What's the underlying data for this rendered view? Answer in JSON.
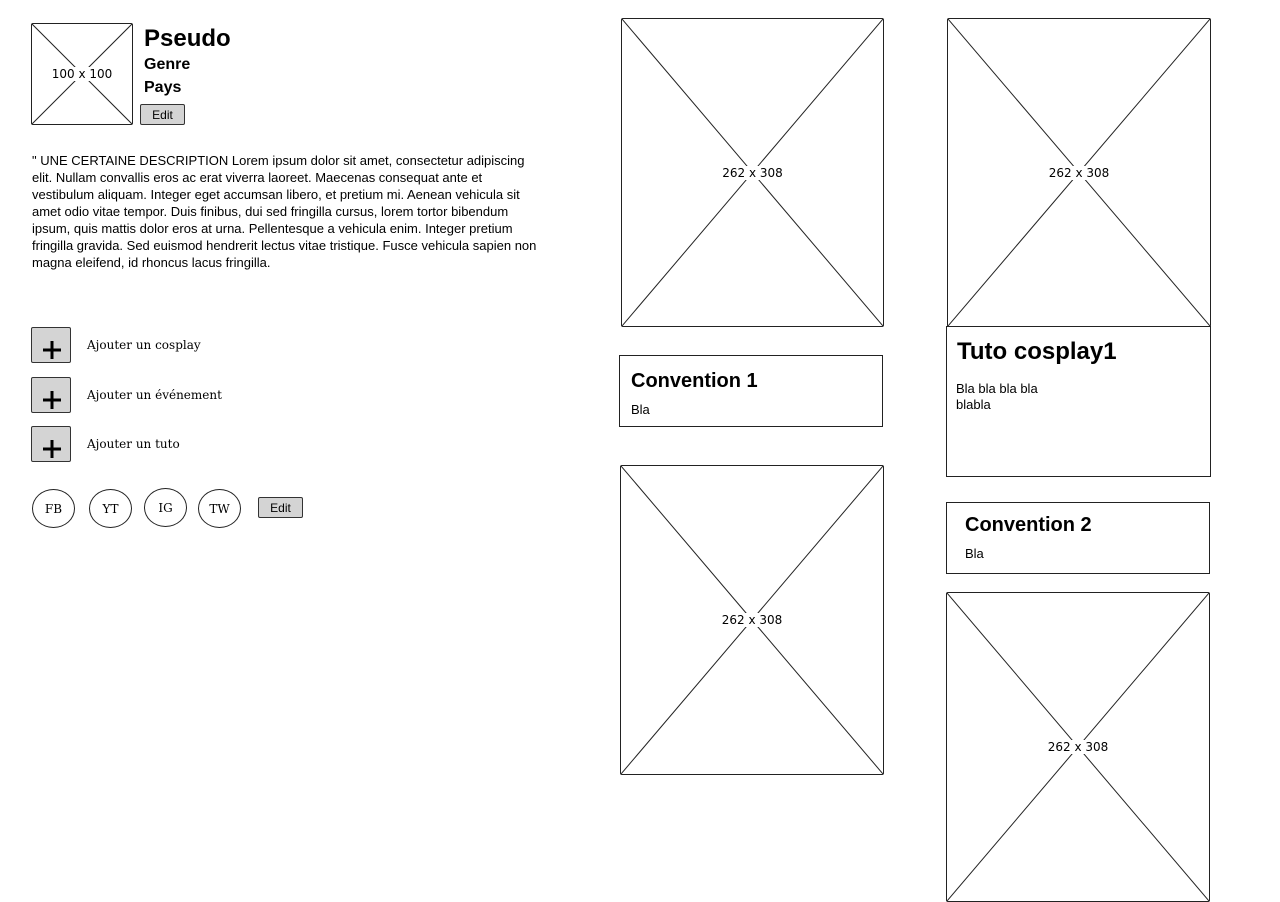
{
  "profile": {
    "avatar_label": "100 x 100",
    "pseudo": "Pseudo",
    "genre": "Genre",
    "pays": "Pays",
    "edit_label": "Edit",
    "description": "\" UNE CERTAINE DESCRIPTION Lorem ipsum dolor sit amet, consectetur adipiscing elit. Nullam convallis eros ac erat viverra laoreet. Maecenas consequat ante et vestibulum aliquam. Integer eget accumsan libero, et pretium mi. Aenean vehicula sit amet odio vitae tempor. Duis finibus, dui sed fringilla cursus, lorem tortor bibendum ipsum, quis mattis dolor eros at urna. Pellentesque a vehicula enim. Integer pretium fringilla gravida. Sed euismod hendrerit lectus vitae tristique. Fusce vehicula sapien non magna eleifend, id rhoncus lacus fringilla."
  },
  "actions": [
    {
      "label": "Ajouter un cosplay",
      "icon": "plus-icon"
    },
    {
      "label": "Ajouter un événement",
      "icon": "plus-icon"
    },
    {
      "label": "Ajouter un tuto",
      "icon": "plus-icon"
    }
  ],
  "social": {
    "links": [
      "FB",
      "YT",
      "IG",
      "TW"
    ],
    "edit_label": "Edit"
  },
  "feed": {
    "image_label": "262 x 308",
    "convention1": {
      "title": "Convention 1",
      "text": "Bla"
    },
    "convention2": {
      "title": "Convention 2",
      "text": "Bla"
    },
    "tuto1": {
      "title": "Tuto cosplay1",
      "text_line1": "Bla bla bla bla",
      "text_line2": "blabla"
    }
  }
}
